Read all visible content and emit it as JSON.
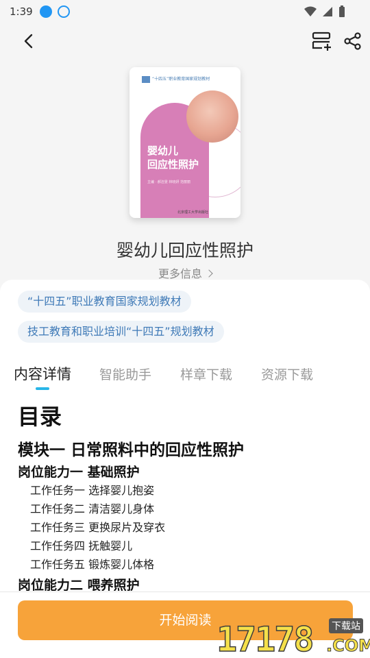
{
  "status_bar": {
    "time": "1:39"
  },
  "icons": {
    "back": "back-arrow-icon",
    "shelf": "add-to-shelf-icon",
    "share": "share-icon"
  },
  "book": {
    "title": "婴幼儿回应性照护",
    "more_info": "更多信息",
    "cover": {
      "series": "“十四五”职业教育国家规划教材",
      "title_line1": "婴幼儿",
      "title_line2": "回应性照护",
      "authors": "主编 · 郝洁雯 林晓妍 范丽丽",
      "publisher": "北京理工大学出版社"
    }
  },
  "tags": [
    "“十四五”职业教育国家规划教材",
    "技工教育和职业培训“十四五”规划教材"
  ],
  "tabs": [
    {
      "label": "内容详情",
      "active": true
    },
    {
      "label": "智能助手",
      "active": false
    },
    {
      "label": "样章下载",
      "active": false
    },
    {
      "label": "资源下载",
      "active": false
    }
  ],
  "toc": {
    "heading": "目录",
    "module": "模块一 日常照料中的回应性照护",
    "ability1": "岗位能力一 基础照护",
    "tasks": [
      "工作任务一 选择婴儿抱姿",
      "工作任务二 清洁婴儿身体",
      "工作任务三 更换尿片及穿衣",
      "工作任务四 抚触婴儿",
      "工作任务五 锻炼婴儿体格"
    ],
    "ability2": "岗位能力二 喂养照护"
  },
  "read_button": "开始阅读",
  "watermark": {
    "digits": "17178",
    "suffix": ".COM",
    "label": "下载站"
  },
  "colors": {
    "accent": "#f7a33a",
    "tab_indicator": "#29b6e8",
    "tag_text": "#3f7ab7",
    "cover_pink": "#d77fb7"
  }
}
